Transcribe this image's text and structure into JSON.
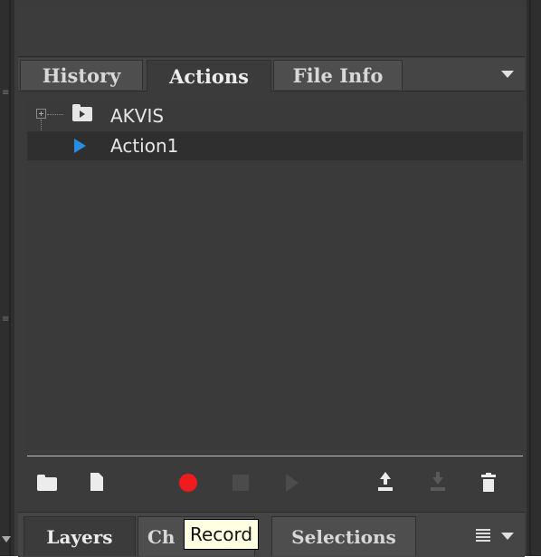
{
  "tabs": [
    {
      "label": "History",
      "active": false
    },
    {
      "label": "Actions",
      "active": true
    },
    {
      "label": "File Info",
      "active": false
    }
  ],
  "tree": [
    {
      "label": "AKVIS",
      "icon": "folder-icon",
      "expandable": true,
      "selected": false
    },
    {
      "label": "Action1",
      "icon": "play-icon",
      "expandable": false,
      "selected": true
    }
  ],
  "toolbar": [
    {
      "name": "new-set-folder-icon",
      "icon": "folder"
    },
    {
      "name": "new-action-page-icon",
      "icon": "page"
    },
    {
      "name": "record-icon",
      "icon": "record",
      "color": "#ee1c1c"
    },
    {
      "name": "stop-icon",
      "icon": "stop",
      "disabled": true
    },
    {
      "name": "play-icon",
      "icon": "play",
      "disabled": true
    },
    {
      "name": "export-upload-icon",
      "icon": "upload"
    },
    {
      "name": "import-download-icon",
      "icon": "download",
      "disabled": true
    },
    {
      "name": "trash-icon",
      "icon": "trash"
    }
  ],
  "bottom_tabs": [
    {
      "label": "Layers",
      "active": true
    },
    {
      "label": "Ch",
      "active": false
    },
    {
      "label": "Selections",
      "active": false
    }
  ],
  "tooltip": {
    "text": "Record"
  },
  "colors": {
    "panel_bg": "#3b3b3b",
    "tab_bg": "#4e4e4e",
    "selected_row": "#2f2f2f",
    "accent_blue": "#2a8ee0",
    "record_red": "#ee1c1c"
  }
}
